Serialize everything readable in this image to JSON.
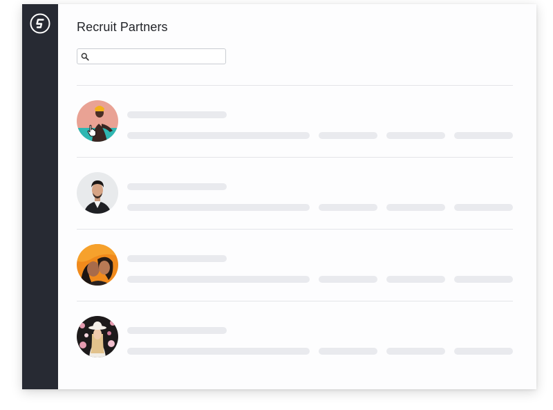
{
  "app": {
    "brand_color": "#272a33",
    "logo_icon": "g-logo-icon"
  },
  "header": {
    "title": "Recruit Partners"
  },
  "search": {
    "value": "",
    "placeholder": "",
    "icon": "search-icon"
  },
  "partners": [
    {
      "avatar": "partner-avatar-1",
      "loading": true
    },
    {
      "avatar": "partner-avatar-2",
      "loading": true
    },
    {
      "avatar": "partner-avatar-3",
      "loading": true
    },
    {
      "avatar": "partner-avatar-4",
      "loading": true
    }
  ],
  "colors": {
    "skeleton": "#e9eaee",
    "divider": "#e3e4e8",
    "sidebar": "#272a33"
  }
}
